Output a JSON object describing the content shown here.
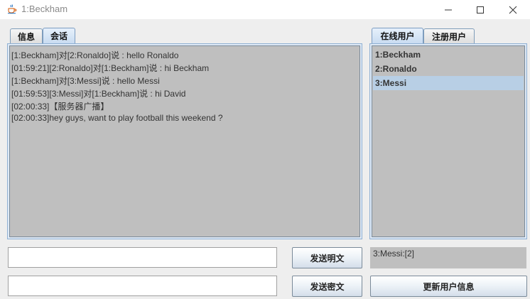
{
  "window": {
    "title": "1:Beckham",
    "icon": "java-cup-icon",
    "controls": [
      "minimize-icon",
      "maximize-icon",
      "close-icon"
    ]
  },
  "left_tabs": [
    {
      "label": "信息",
      "active": false
    },
    {
      "label": "会话",
      "active": true
    }
  ],
  "chat_lines": [
    "[1:Beckham]对[2:Ronaldo]说 : hello Ronaldo",
    "[01:59:21][2:Ronaldo]对[1:Beckham]说 : hi Beckham",
    "[1:Beckham]对[3:Messi]说 : hello Messi",
    "[01:59:53][3:Messi]对[1:Beckham]说 : hi David",
    "[02:00:33]【服务器广播】",
    "[02:00:33]hey guys, want to play football this weekend ?"
  ],
  "right_tabs": [
    {
      "label": "在线用户",
      "active": true
    },
    {
      "label": "注册用户",
      "active": false
    }
  ],
  "users": [
    {
      "label": "1:Beckham",
      "selected": false
    },
    {
      "label": "2:Ronaldo",
      "selected": false
    },
    {
      "label": "3:Messi",
      "selected": true
    }
  ],
  "inputs": {
    "plain_message": {
      "value": "",
      "placeholder": ""
    },
    "encrypted_message": {
      "value": "",
      "placeholder": ""
    }
  },
  "buttons": {
    "send_plain": "发送明文",
    "send_encrypted": "发送密文",
    "update_user_info": "更新用户信息"
  },
  "status_text": "3:Messi:[2]",
  "colors": {
    "panel_bg": "#bfbfbf",
    "selection": "#b8cfe5",
    "window_bg": "#eeeeee"
  }
}
